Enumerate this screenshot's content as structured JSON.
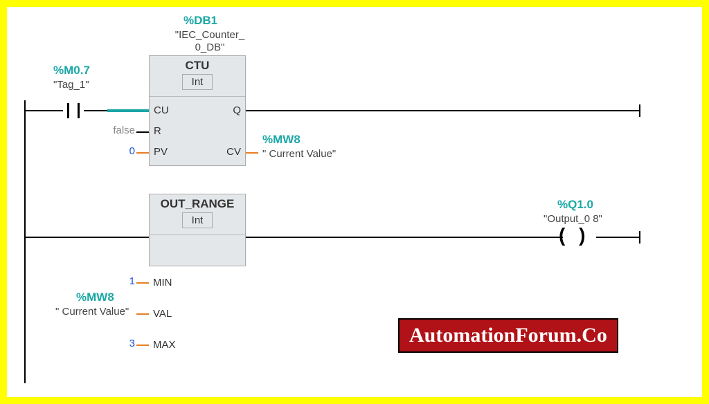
{
  "network1": {
    "contact": {
      "address": "%M0.7",
      "tag": "\"Tag_1\""
    },
    "block": {
      "db_address": "%DB1",
      "db_name_line1": "\"IEC_Counter_",
      "db_name_line2": "0_DB\"",
      "type": "CTU",
      "datatype": "Int",
      "pins": {
        "cu": "CU",
        "r": "R",
        "pv": "PV",
        "q": "Q",
        "cv": "CV"
      },
      "r_value": "false",
      "pv_value": "0",
      "cv_address": "%MW8",
      "cv_tag": "\" Current Value\""
    }
  },
  "network2": {
    "block": {
      "type": "OUT_RANGE",
      "datatype": "Int",
      "pins": {
        "min": "MIN",
        "val": "VAL",
        "max": "MAX"
      },
      "min_value": "1",
      "val_address": "%MW8",
      "val_tag": "\" Current Value\"",
      "max_value": "3"
    },
    "coil": {
      "address": "%Q1.0",
      "tag": "\"Output_0 8\""
    }
  },
  "watermark": "AutomationForum.Co"
}
